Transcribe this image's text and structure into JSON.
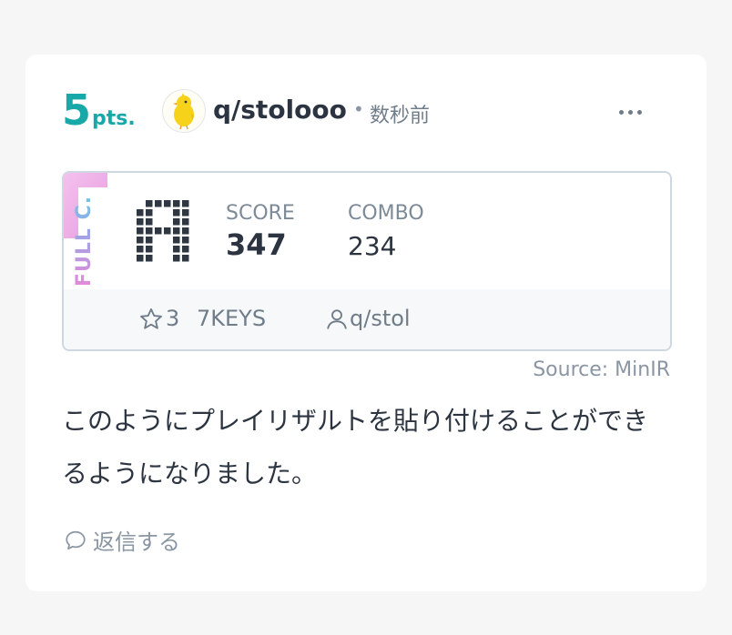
{
  "post": {
    "points_value": "5",
    "points_unit": "pts.",
    "username": "q/stolooo",
    "separator": "•",
    "timestamp": "数秒前",
    "more_menu_icon": "more-horizontal-icon",
    "avatar_icon": "chick-icon"
  },
  "result": {
    "lamp": "FULL C.",
    "rank": "A",
    "score_label": "SCORE",
    "score_value": "347",
    "combo_label": "COMBO",
    "combo_value": "234",
    "level": "3",
    "keys": "7KEYS",
    "player": "q/stol",
    "colors": {
      "lamp_start": "#e48ad7",
      "lamp_end": "#6fc6e8",
      "border": "#cfd8e0"
    }
  },
  "source": "Source: MinIR",
  "body": "このようにプレイリザルトを貼り付けることができるようになりました。",
  "reply_label": "返信する",
  "colors": {
    "points": "#17a9a8",
    "text": "#2b3440",
    "muted": "#8a96a3"
  }
}
